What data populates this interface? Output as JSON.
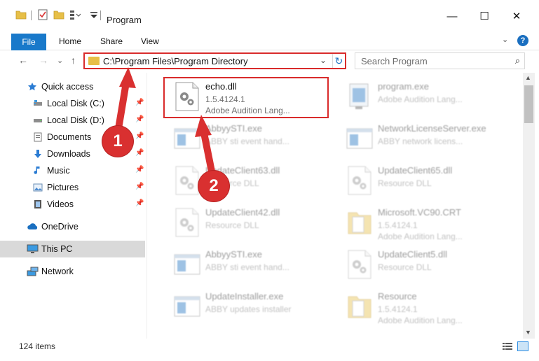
{
  "window": {
    "title": "Program",
    "minimize": "—",
    "maximize": "☐",
    "close": "✕"
  },
  "ribbon": {
    "tabs": [
      "File",
      "Home",
      "Share",
      "View"
    ],
    "help": "?",
    "collapse": "⌄"
  },
  "nav": {
    "back": "←",
    "forward": "→",
    "recent": "⌄",
    "up": "↑"
  },
  "address": {
    "path": "C:\\Program Files\\Program Directory",
    "dropdown": "⌄",
    "refresh": "↻"
  },
  "search": {
    "placeholder": "Search Program",
    "icon": "⌕"
  },
  "sidebar": {
    "items": [
      {
        "label": "Quick access",
        "icon": "star-icon",
        "pinned": false
      },
      {
        "label": "Local Disk (C:)",
        "icon": "drive-icon",
        "pinned": true
      },
      {
        "label": "Local Disk (D:)",
        "icon": "drive-icon",
        "pinned": true
      },
      {
        "label": "Documents",
        "icon": "documents-icon",
        "pinned": true
      },
      {
        "label": "Downloads",
        "icon": "downloads-icon",
        "pinned": true
      },
      {
        "label": "Music",
        "icon": "music-icon",
        "pinned": true
      },
      {
        "label": "Pictures",
        "icon": "pictures-icon",
        "pinned": true
      },
      {
        "label": "Videos",
        "icon": "videos-icon",
        "pinned": true
      },
      {
        "label": "OneDrive",
        "icon": "onedrive-icon",
        "pinned": false
      },
      {
        "label": "This PC",
        "icon": "computer-icon",
        "pinned": false
      },
      {
        "label": "Network",
        "icon": "network-icon",
        "pinned": false
      }
    ],
    "pin_glyph": "📌"
  },
  "files": [
    {
      "name": "echo.dll",
      "line2": "1.5.4124.1",
      "line3": "Adobe Audition Lang...",
      "icon": "dll-gear-icon",
      "highlighted": true
    },
    {
      "name": "program.exe",
      "line2": "Adobe Audition Lang...",
      "line3": "",
      "icon": "exe-app-icon",
      "highlighted": false
    },
    {
      "name": "AbbyySTI.exe",
      "line2": "ABBY sti event hand...",
      "line3": "",
      "icon": "exe-window-icon",
      "highlighted": false
    },
    {
      "name": "NetworkLicenseServer.exe",
      "line2": "ABBY network licens...",
      "line3": "",
      "icon": "exe-window-icon",
      "highlighted": false
    },
    {
      "name": "UpdateClient63.dll",
      "line2": "Resource DLL",
      "line3": "",
      "icon": "dll-gear-icon",
      "highlighted": false
    },
    {
      "name": "UpdateClient65.dll",
      "line2": "Resource DLL",
      "line3": "",
      "icon": "dll-gear-icon",
      "highlighted": false
    },
    {
      "name": "UpdateClient42.dll",
      "line2": "Resource DLL",
      "line3": "",
      "icon": "dll-gear-icon",
      "highlighted": false
    },
    {
      "name": "Microsoft.VC90.CRT",
      "line2": "1.5.4124.1",
      "line3": "Adobe Audition Lang...",
      "icon": "manifest-icon",
      "highlighted": false
    },
    {
      "name": "AbbyySTI.exe",
      "line2": "ABBY sti event hand...",
      "line3": "",
      "icon": "exe-window-icon",
      "highlighted": false
    },
    {
      "name": "UpdateClient5.dll",
      "line2": "Resource DLL",
      "line3": "",
      "icon": "dll-gear-icon",
      "highlighted": false
    },
    {
      "name": "UpdateInstaller.exe",
      "line2": "ABBY updates installer",
      "line3": "",
      "icon": "exe-window-icon",
      "highlighted": false
    },
    {
      "name": "Resource",
      "line2": "1.5.4124.1",
      "line3": "Adobe Audition Lang...",
      "icon": "manifest-icon",
      "highlighted": false
    }
  ],
  "status": {
    "item_count": "124 items"
  },
  "annotations": [
    {
      "number": "1",
      "target": "address-bar"
    },
    {
      "number": "2",
      "target": "echo-dll-file"
    }
  ],
  "colors": {
    "accent": "#1979ca",
    "highlight": "#d92b2b",
    "folder": "#e7bf47",
    "selected_nav": "#d9d9d9"
  }
}
